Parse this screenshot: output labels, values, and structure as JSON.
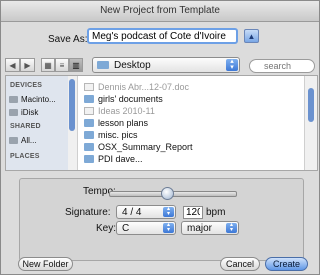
{
  "window": {
    "title": "New Project from Template"
  },
  "save_as": {
    "label": "Save As:",
    "value": "Meg's podcast of Cote d'Ivoire"
  },
  "toolbar": {
    "location_label": "Desktop",
    "search_placeholder": "search"
  },
  "sidebar": {
    "devices_header": "DEVICES",
    "devices": [
      {
        "label": "Macinto..."
      },
      {
        "label": "iDisk"
      }
    ],
    "shared_header": "SHARED",
    "shared": [
      {
        "label": "All..."
      }
    ],
    "places_header": "PLACES"
  },
  "files": [
    {
      "name": "Dennis Abr...12-07.doc",
      "icon": "doc",
      "dim": true
    },
    {
      "name": "girls' documents",
      "icon": "folder",
      "dim": false
    },
    {
      "name": "Ideas 2010-11",
      "icon": "doc",
      "dim": true
    },
    {
      "name": "lesson plans",
      "icon": "folder",
      "dim": false
    },
    {
      "name": "misc. pics",
      "icon": "folder",
      "dim": false
    },
    {
      "name": "OSX_Summary_Report",
      "icon": "folder",
      "dim": false
    },
    {
      "name": "PDI dave...",
      "icon": "folder",
      "dim": false
    }
  ],
  "settings": {
    "tempo_label": "Tempo:",
    "tempo_position": 0.45,
    "signature_label": "Signature:",
    "signature_value": "4 / 4",
    "bpm_value": "120",
    "bpm_unit": "bpm",
    "key_label": "Key:",
    "key_value": "C",
    "mode_value": "major"
  },
  "buttons": {
    "new_folder": "New Folder",
    "cancel": "Cancel",
    "create": "Create"
  }
}
